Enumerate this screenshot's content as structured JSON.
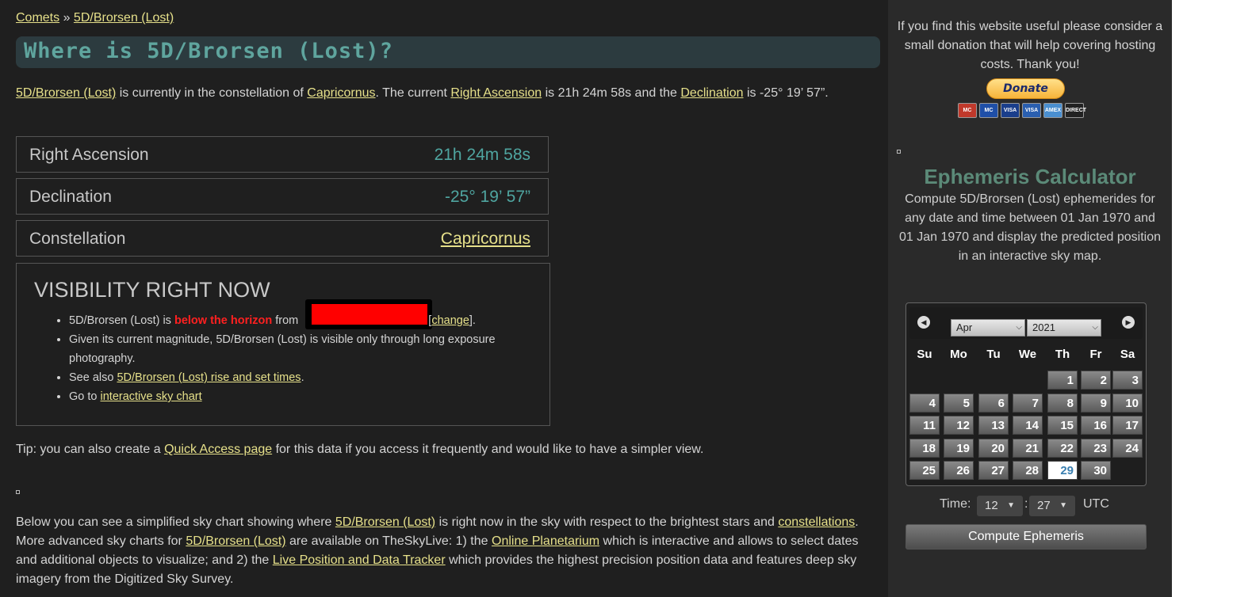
{
  "breadcrumb": {
    "comets": "Comets",
    "sep": " » ",
    "current": "5D/Brorsen (Lost)"
  },
  "title": "Where is 5D/Brorsen (Lost)?",
  "intro": {
    "object": "5D/Brorsen (Lost)",
    "t1": " is currently in the constellation of ",
    "constellation": "Capricornus",
    "t2": ". The current ",
    "ra_link": "Right Ascension",
    "t3": " is 21h 24m 58s and the ",
    "dec_link": "Declination",
    "t4": " is -25° 19’ 57”."
  },
  "rows": [
    {
      "label": "Right Ascension",
      "value": "21h 24m 58s"
    },
    {
      "label": "Declination",
      "value": "-25° 19’ 57”"
    },
    {
      "label": "Constellation",
      "value": "Capricornus"
    }
  ],
  "visibility": {
    "heading": "VISIBILITY RIGHT NOW",
    "i1a": "5D/Brorsen (Lost) is ",
    "i1b": "below the horizon",
    "i1c": " from ",
    "i1d": "[",
    "i1e": "change",
    "i1f": "].",
    "i2": "Given its current magnitude, 5D/Brorsen (Lost) is visible only through long exposure photography.",
    "i3a": "See also ",
    "i3b": "5D/Brorsen (Lost) rise and set times",
    "i3c": ".",
    "i4a": "Go to ",
    "i4b": "interactive sky chart"
  },
  "tip": {
    "a": "Tip: you can also create a ",
    "link": "Quick Access page",
    "b": " for this data if you access it frequently and would like to have a simpler view."
  },
  "below": {
    "a": "Below you can see a simplified sky chart showing where ",
    "l1": "5D/Brorsen (Lost)",
    "b": " is right now in the sky with respect to the brightest stars and ",
    "l2": "constellations",
    "c": ". More advanced sky charts for ",
    "l3": "5D/Brorsen (Lost)",
    "d": " are available on TheSkyLive: 1) the ",
    "l4": "Online Planetarium",
    "e": " which is interactive and allows to select dates and additional objects to visualize; and 2) the ",
    "l5": "Live Position and Data Tracker",
    "f": " which provides the highest precision position data and features deep sky imagery from the Digitized Sky Survey."
  },
  "sidebar": {
    "donate_text": "If you find this website useful please consider a small donation that will help covering hosting costs. Thank you!",
    "donate_label": "Donate",
    "cards": [
      {
        "label": "MC",
        "color": "#c0392b"
      },
      {
        "label": "MC",
        "color": "#1f4fa8"
      },
      {
        "label": "VISA",
        "color": "#1a3e8c"
      },
      {
        "label": "VISA",
        "color": "#2a5fb0"
      },
      {
        "label": "AMEX",
        "color": "#4a8fd0"
      },
      {
        "label": "DIRECT",
        "color": "#222222"
      }
    ],
    "eph_title": "Ephemeris Calculator",
    "eph_desc": "Compute 5D/Brorsen (Lost) ephemerides for any date and time between 01 Jan 1970 and 01 Jan 1970 and display the predicted position in an interactive sky map.",
    "calendar": {
      "month": "Apr",
      "year": "2021",
      "weekdays": [
        "Su",
        "Mo",
        "Tu",
        "We",
        "Th",
        "Fr",
        "Sa"
      ],
      "days": [
        "1",
        "2",
        "3",
        "4",
        "5",
        "6",
        "7",
        "8",
        "9",
        "10",
        "11",
        "12",
        "13",
        "14",
        "15",
        "16",
        "17",
        "18",
        "19",
        "20",
        "21",
        "22",
        "23",
        "24",
        "25",
        "26",
        "27",
        "28",
        "29",
        "30"
      ],
      "first_weekday": 4,
      "today": "29"
    },
    "time_label": "Time:",
    "hour": "12",
    "minute": "27",
    "tz": "UTC",
    "compute_label": "Compute Ephemeris"
  }
}
